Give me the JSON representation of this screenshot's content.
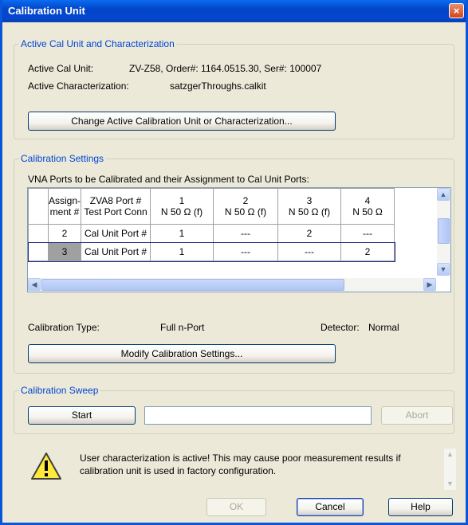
{
  "window": {
    "title": "Calibration Unit",
    "close_glyph": "×"
  },
  "active_cal": {
    "legend": "Active Cal Unit and Characterization",
    "unit_label": "Active Cal Unit:",
    "unit_value": "ZV-Z58, Order#: 1164.0515.30, Ser#: 100007",
    "char_label": "Active Characterization:",
    "char_value": "satzgerThroughs.calkit",
    "change_button": "Change Active Calibration Unit or Characterization..."
  },
  "cal_settings": {
    "legend": "Calibration Settings",
    "table_caption": "VNA Ports to be Calibrated and their Assignment to Cal Unit Ports:",
    "headers": [
      "Assign-\nment #",
      "ZVA8 Port #\nTest Port Conn",
      "1\nN 50 Ω (f)",
      "2\nN 50 Ω (f)",
      "3\nN 50 Ω (f)",
      "4\nN 50 Ω"
    ],
    "rows": [
      {
        "assignment": "2",
        "label": "Cal Unit Port #",
        "p1": "1",
        "p2": "---",
        "p3": "2",
        "p4": "---"
      },
      {
        "assignment": "3",
        "label": "Cal Unit Port #",
        "p1": "1",
        "p2": "---",
        "p3": "---",
        "p4": "2"
      }
    ],
    "cal_type_label": "Calibration Type:",
    "cal_type_value": "Full n-Port",
    "detector_label": "Detector:",
    "detector_value": "Normal",
    "modify_button": "Modify Calibration Settings..."
  },
  "sweep": {
    "legend": "Calibration Sweep",
    "start_button": "Start",
    "progress_text": "",
    "abort_button": "Abort"
  },
  "warning": {
    "icon": "warning-icon",
    "message": "User characterization is active! This may cause poor measurement results if calibration unit is used in factory configuration."
  },
  "footer": {
    "ok": "OK",
    "cancel": "Cancel",
    "help": "Help"
  },
  "colors": {
    "accent": "#0046d5",
    "titlebar": "#0346c9",
    "selected_cell": "#a0a0a0"
  }
}
